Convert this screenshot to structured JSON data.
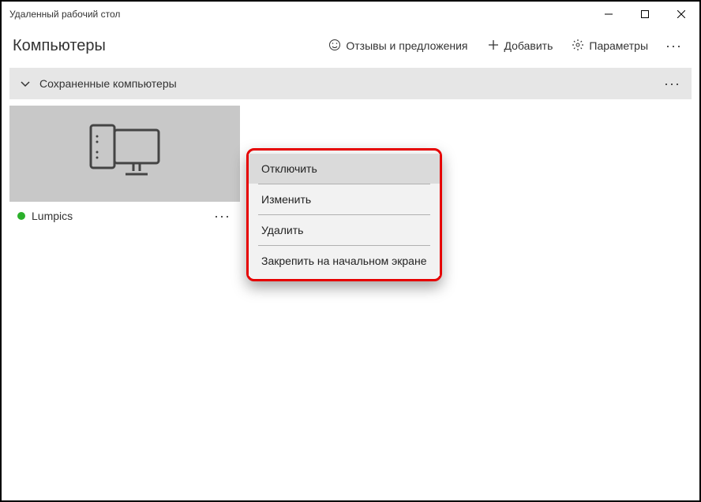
{
  "titlebar": {
    "title": "Удаленный рабочий стол"
  },
  "header": {
    "title": "Компьютеры",
    "feedback": "Отзывы и предложения",
    "add": "Добавить",
    "settings": "Параметры"
  },
  "section": {
    "title": "Сохраненные компьютеры"
  },
  "tile": {
    "name": "Lumpics",
    "status_color": "#2bb02b"
  },
  "menu": {
    "disconnect": "Отключить",
    "edit": "Изменить",
    "delete": "Удалить",
    "pin": "Закрепить на начальном экране"
  }
}
